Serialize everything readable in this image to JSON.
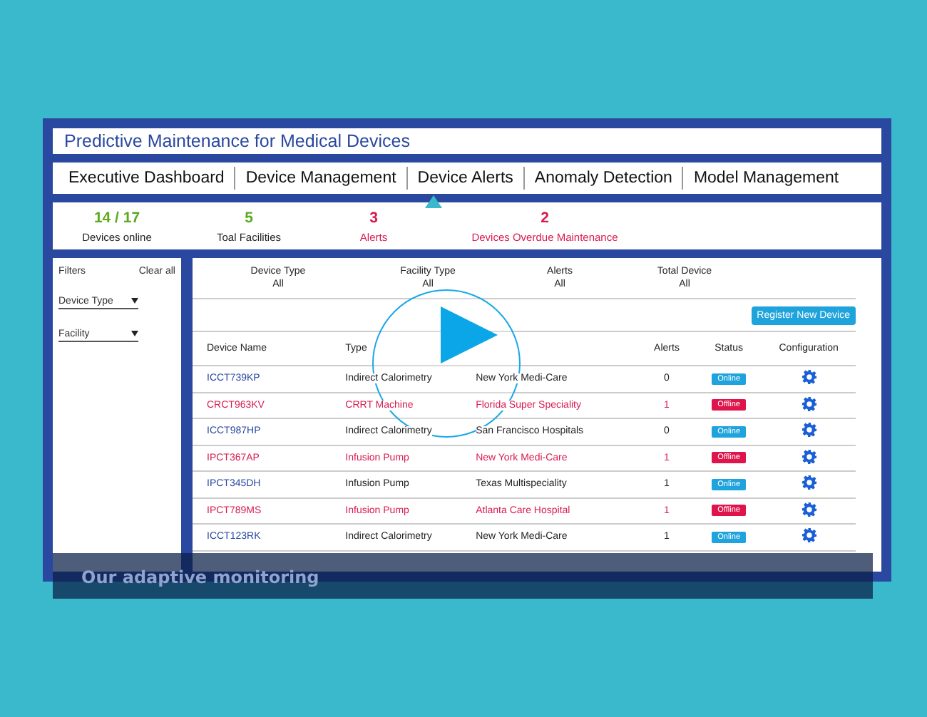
{
  "app_title": "Predictive Maintenance for Medical Devices",
  "tabs": [
    {
      "label": "Executive Dashboard",
      "selected": false
    },
    {
      "label": "Device Management",
      "selected": false
    },
    {
      "label": "Device Alerts",
      "selected": true
    },
    {
      "label": "Anomaly Detection",
      "selected": false
    },
    {
      "label": "Model Management",
      "selected": false
    }
  ],
  "stats": [
    {
      "value": "14 / 17",
      "label": "Devices online",
      "color": "#5aaa1e"
    },
    {
      "value": "5",
      "label": "Toal Facilities",
      "color": "#5aaa1e"
    },
    {
      "value": "3",
      "label": "Alerts",
      "color": "#d81b4f"
    },
    {
      "value": "2",
      "label": "Devices Overdue Maintenance",
      "color": "#d81b4f"
    }
  ],
  "filters": {
    "title": "Filters",
    "clear": "Clear all",
    "dropdowns": [
      "Device Type",
      "Facility"
    ]
  },
  "summary": [
    {
      "label": "Device Type",
      "value": "All"
    },
    {
      "label": "Facility Type",
      "value": "All"
    },
    {
      "label": "Alerts",
      "value": "All"
    },
    {
      "label": "Total Device",
      "value": "All"
    }
  ],
  "register_button": "Register New Device",
  "columns": [
    "Device  Name",
    "Type",
    "Alerts",
    "Status",
    "Configuration"
  ],
  "rows": [
    {
      "name": "ICCT739KP",
      "type": "Indirect Calorimetry",
      "facility": "New York Medi-Care",
      "alerts": "0",
      "status": "Online",
      "kind": "online"
    },
    {
      "name": "CRCT963KV",
      "type": "CRRT Machine",
      "facility": "Florida Super Speciality",
      "alerts": "1",
      "status": "Offline",
      "kind": "offline"
    },
    {
      "name": "ICCT987HP",
      "type": "Indirect Calorimetry",
      "facility": "San Francisco Hospitals",
      "alerts": "0",
      "status": "Online",
      "kind": "online"
    },
    {
      "name": "IPCT367AP",
      "type": "Infusion Pump",
      "facility": "New York Medi-Care",
      "alerts": "1",
      "status": "Offline",
      "kind": "offline"
    },
    {
      "name": "IPCT345DH",
      "type": "Infusion Pump",
      "facility": "Texas Multispeciality",
      "alerts": "1",
      "status": "Online",
      "kind": "online"
    },
    {
      "name": "IPCT789MS",
      "type": "Infusion Pump",
      "facility": "Atlanta Care Hospital",
      "alerts": "1",
      "status": "Offline",
      "kind": "offline"
    },
    {
      "name": "ICCT123RK",
      "type": "Indirect Calorimetry",
      "facility": "New York Medi-Care",
      "alerts": "1",
      "status": "Online",
      "kind": "online"
    }
  ],
  "caption": "Our adaptive monitoring"
}
